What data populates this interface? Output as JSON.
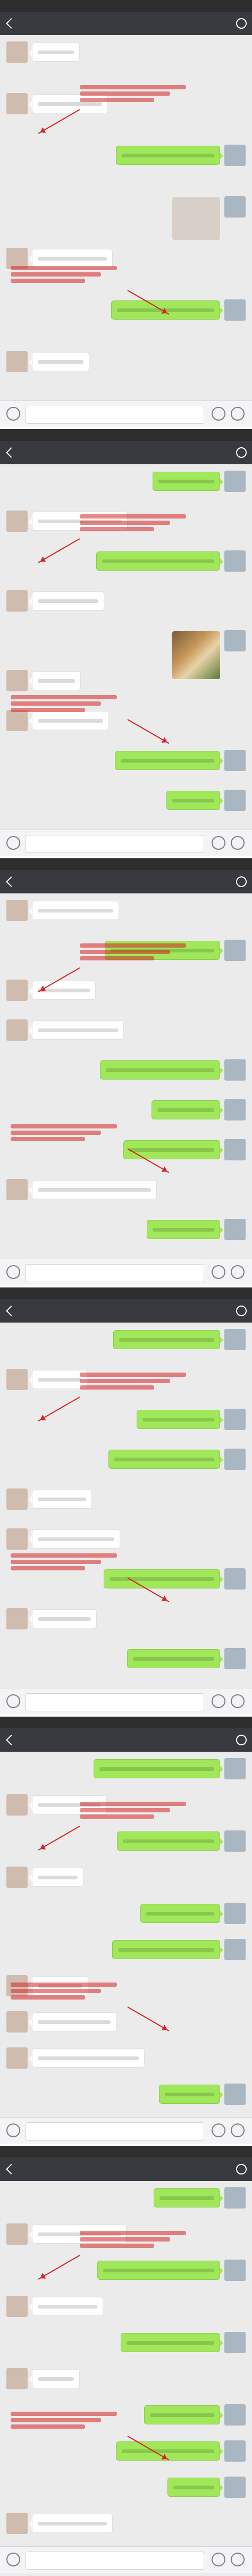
{
  "colors": {
    "nav_bg": "#393a3f",
    "status_bg": "#2e2e2e",
    "chat_bg": "#ebebeb",
    "bubble_self": "#a0e75a",
    "bubble_other": "#ffffff",
    "annotation": "#d62424"
  },
  "icons": {
    "back": "chevron-left-icon",
    "contact": "person-icon",
    "voice": "voice-icon",
    "emoji": "emoji-icon",
    "add": "plus-icon"
  },
  "screens": [
    {
      "title": "",
      "status": "",
      "messages": [
        {
          "from": "other"
        },
        {
          "from": "other"
        },
        {
          "from": "self"
        },
        {
          "from": "self",
          "kind": "sticker"
        },
        {
          "from": "other"
        },
        {
          "from": "self"
        },
        {
          "from": "other"
        }
      ],
      "notes": [
        "",
        ""
      ]
    },
    {
      "title": "",
      "status": "",
      "messages": [
        {
          "from": "self"
        },
        {
          "from": "other"
        },
        {
          "from": "self"
        },
        {
          "from": "other"
        },
        {
          "from": "self",
          "kind": "photo"
        },
        {
          "from": "other"
        },
        {
          "from": "other"
        },
        {
          "from": "self"
        },
        {
          "from": "self"
        }
      ],
      "notes": [
        "",
        ""
      ]
    },
    {
      "title": "",
      "status": "",
      "messages": [
        {
          "from": "other"
        },
        {
          "from": "self"
        },
        {
          "from": "other"
        },
        {
          "from": "other"
        },
        {
          "from": "self"
        },
        {
          "from": "self"
        },
        {
          "from": "self"
        },
        {
          "from": "other"
        },
        {
          "from": "self"
        }
      ],
      "notes": [
        "",
        ""
      ]
    },
    {
      "title": "",
      "status": "",
      "messages": [
        {
          "from": "self"
        },
        {
          "from": "other"
        },
        {
          "from": "self"
        },
        {
          "from": "self"
        },
        {
          "from": "other"
        },
        {
          "from": "other"
        },
        {
          "from": "self"
        },
        {
          "from": "other"
        },
        {
          "from": "self"
        }
      ],
      "notes": [
        "",
        ""
      ]
    },
    {
      "title": "",
      "status": "",
      "messages": [
        {
          "from": "self"
        },
        {
          "from": "other"
        },
        {
          "from": "self"
        },
        {
          "from": "other"
        },
        {
          "from": "self"
        },
        {
          "from": "self"
        },
        {
          "from": "other"
        },
        {
          "from": "other"
        },
        {
          "from": "other"
        },
        {
          "from": "self"
        }
      ],
      "notes": [
        "",
        ""
      ]
    },
    {
      "title": "",
      "status": "",
      "messages": [
        {
          "from": "self"
        },
        {
          "from": "other"
        },
        {
          "from": "self"
        },
        {
          "from": "other"
        },
        {
          "from": "self"
        },
        {
          "from": "other"
        },
        {
          "from": "self"
        },
        {
          "from": "self"
        },
        {
          "from": "self"
        },
        {
          "from": "other"
        }
      ],
      "notes": [
        "",
        ""
      ]
    }
  ]
}
